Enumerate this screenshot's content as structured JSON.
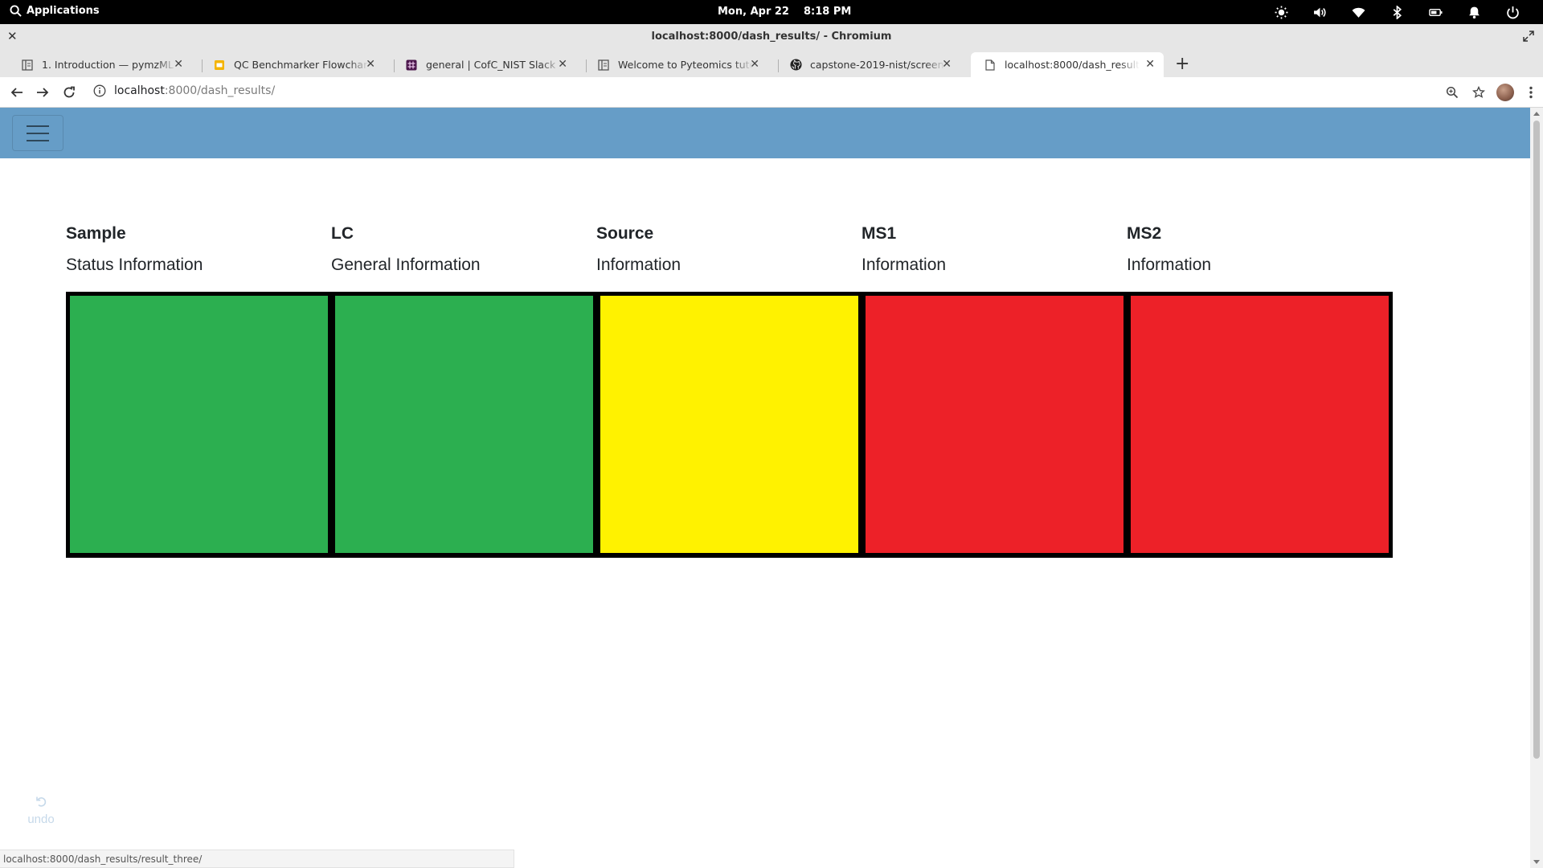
{
  "system": {
    "apps_label": "Applications",
    "date": "Mon, Apr 22",
    "time": "8:18 PM"
  },
  "window": {
    "title": "localhost:8000/dash_results/ - Chromium"
  },
  "tabs": [
    {
      "label": "1. Introduction — pymzML 2.0.6 documentation",
      "icon": "doc-icon",
      "active": false
    },
    {
      "label": "QC Benchmarker Flowcharts - Google Slides",
      "icon": "slides-icon",
      "active": false
    },
    {
      "label": "general | CofC_NIST Slack",
      "icon": "slack-icon",
      "active": false
    },
    {
      "label": "Welcome to Pyteomics tutorial!",
      "icon": "doc-icon",
      "active": false
    },
    {
      "label": "capstone-2019-nist/screenshots",
      "icon": "github-icon",
      "active": false
    },
    {
      "label": "localhost:8000/dash_results/",
      "icon": "page-icon",
      "active": true
    }
  ],
  "address": {
    "host": "localhost",
    "path": ":8000/dash_results/"
  },
  "columns": [
    {
      "heading": "Sample",
      "sub": "Status Information",
      "status": "green"
    },
    {
      "heading": "LC",
      "sub": "General Information",
      "status": "green"
    },
    {
      "heading": "Source",
      "sub": "Information",
      "status": "yellow"
    },
    {
      "heading": "MS1",
      "sub": "Information",
      "status": "red"
    },
    {
      "heading": "MS2",
      "sub": "Information",
      "status": "red"
    }
  ],
  "status_colors": {
    "green": "#2caf50",
    "yellow": "#fff200",
    "red": "#ed2128"
  },
  "undo_label": "undo",
  "status_url": "localhost:8000/dash_results/result_three/"
}
